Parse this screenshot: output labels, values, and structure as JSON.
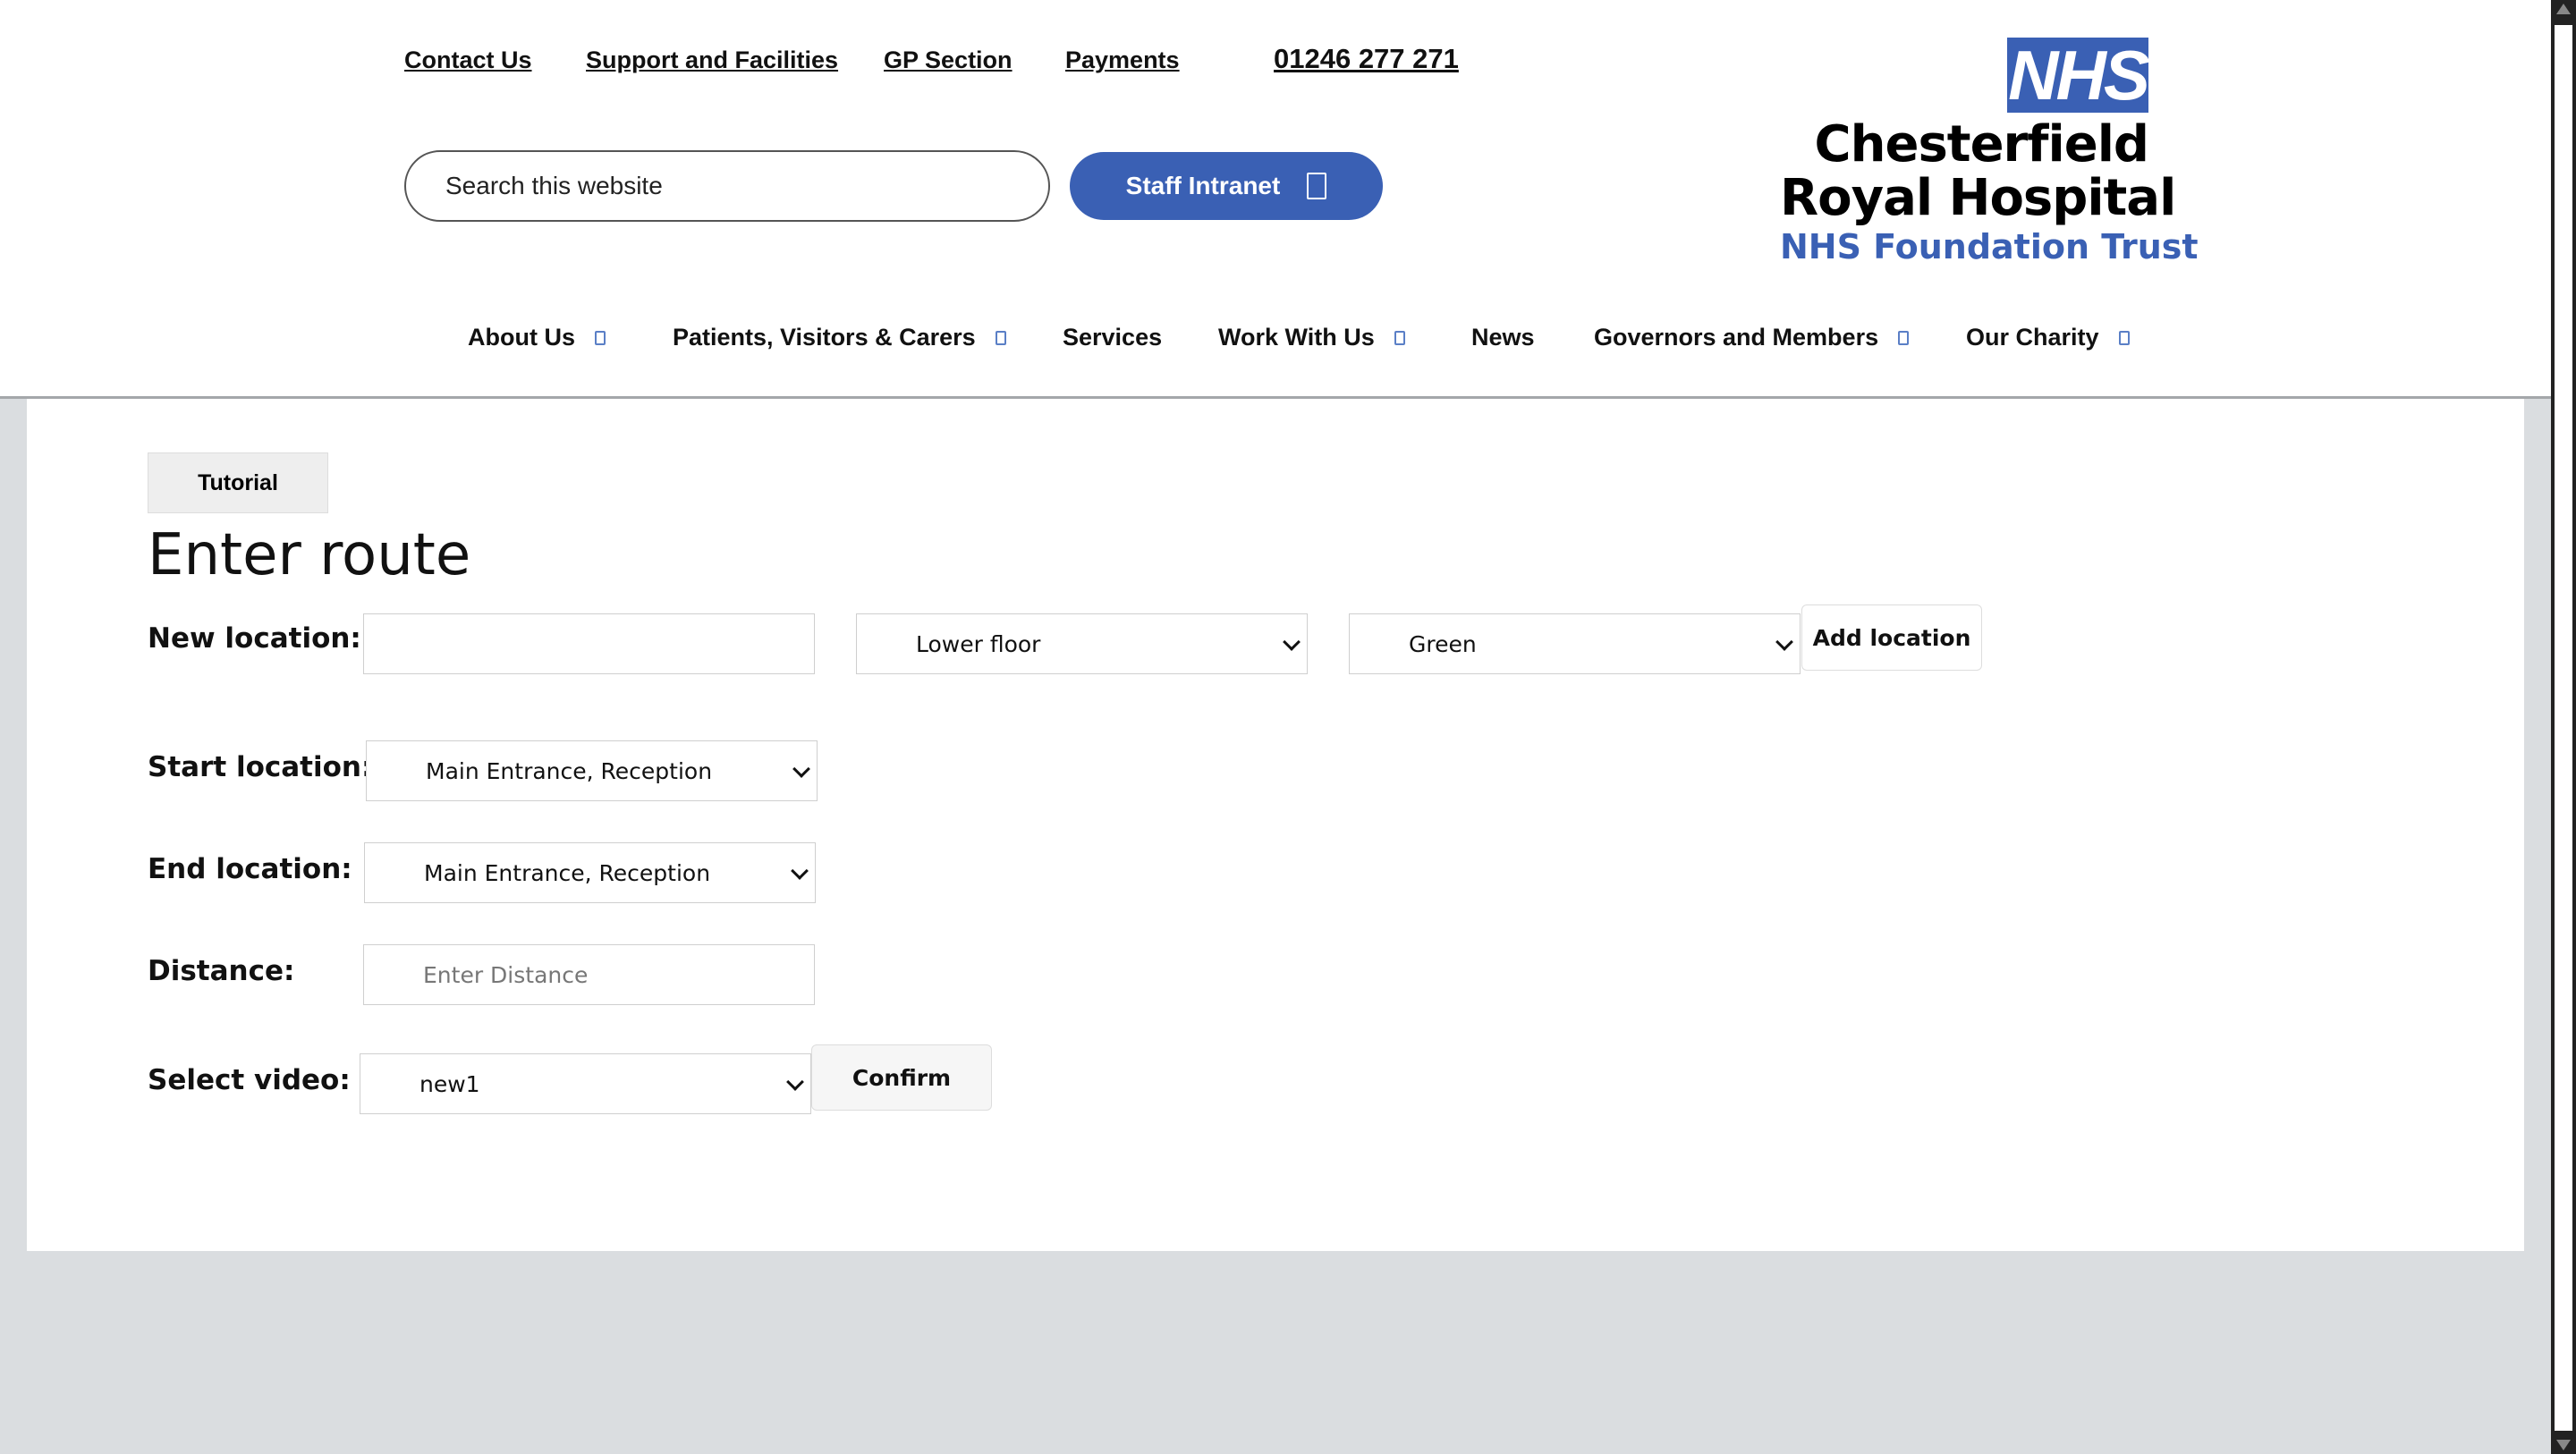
{
  "header": {
    "top_links": [
      "Contact Us",
      "Support and Facilities",
      "GP Section",
      "Payments"
    ],
    "phone": "01246 277 271",
    "search_placeholder": "Search this website",
    "staff_intranet": "Staff Intranet",
    "logo": {
      "mark": "NHS",
      "line1": "Chesterfield",
      "line2": "Royal Hospital",
      "line3": "NHS Foundation Trust"
    },
    "nav": [
      "About Us",
      "Patients, Visitors & Carers",
      "Services",
      "Work With Us",
      "News",
      "Governors and Members",
      "Our Charity"
    ]
  },
  "main": {
    "tutorial_button": "Tutorial",
    "title": "Enter route",
    "new_location": {
      "label": "New location:",
      "name_value": "",
      "floor_value": "Lower floor",
      "color_value": "Green",
      "add_button": "Add location"
    },
    "start_location": {
      "label": "Start location:",
      "value": "Main Entrance, Reception"
    },
    "end_location": {
      "label": "End location:",
      "value": "Main Entrance, Reception"
    },
    "distance": {
      "label": "Distance:",
      "placeholder": "Enter Distance"
    },
    "select_video": {
      "label": "Select video:",
      "value": "new1",
      "confirm_button": "Confirm"
    }
  },
  "colors": {
    "nhs_blue": "#3a60b4",
    "page_background": "#dadde0"
  },
  "icons": {
    "nav_dropdown": "chevron-down-icon",
    "staff_intranet": "external-link-icon",
    "select_arrow": "chevron-down-icon"
  }
}
